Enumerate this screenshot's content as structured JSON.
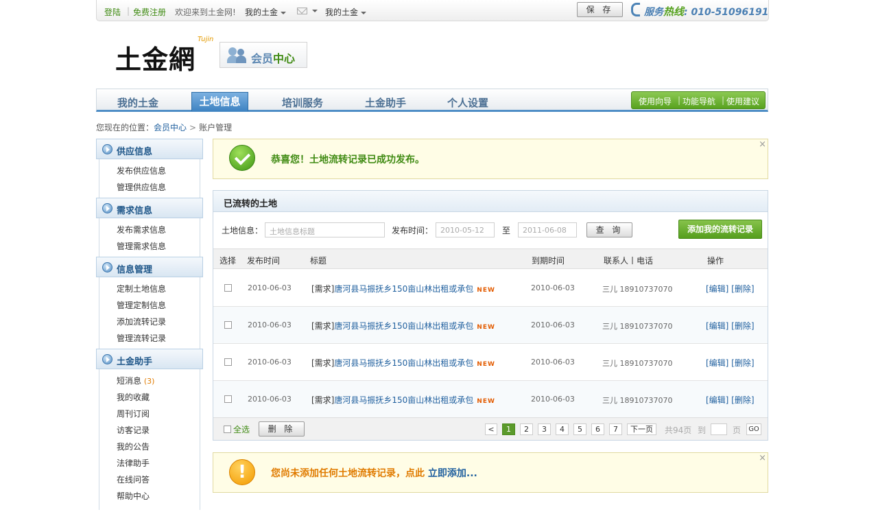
{
  "topbar": {
    "login": "登陆",
    "register": "免费注册",
    "welcome": "欢迎来到土金网!",
    "my_tujin_1": "我的土金",
    "my_tujin_2": "我的土金",
    "save": "保 存",
    "hotline_label": "服务",
    "hotline_hot": "热线",
    "hotline_number": "010-51096191"
  },
  "logo": {
    "text": "土金網",
    "sub": "Tujin",
    "member_a": "会员",
    "member_b": "中心"
  },
  "nav": {
    "items": [
      "我的土金",
      "土地信息",
      "培训服务",
      "土金助手",
      "个人设置"
    ],
    "active": "土地信息",
    "quick": [
      "使用向导",
      "功能导航",
      "使用建议"
    ]
  },
  "breadcrumb": {
    "prefix": "您现在的位置：",
    "link": "会员中心",
    "current": "账户管理"
  },
  "sidebar": {
    "sections": [
      {
        "title": "供应信息",
        "items": [
          "发布供应信息",
          "管理供应信息"
        ]
      },
      {
        "title": "需求信息",
        "items": [
          "发布需求信息",
          "管理需求信息"
        ]
      },
      {
        "title": "信息管理",
        "items": [
          "定制土地信息",
          "管理定制信息",
          "添加流转记录",
          "管理流转记录"
        ]
      },
      {
        "title": "土金助手",
        "items": [
          "短消息",
          "我的收藏",
          "周刊订阅",
          "访客记录",
          "我的公告",
          "法律助手",
          "在线问答",
          "帮助中心"
        ],
        "badge": "(3)"
      }
    ]
  },
  "success": {
    "message": "恭喜您！土地流转记录已成功发布。",
    "close": "×"
  },
  "panel": {
    "title": "已流转的土地",
    "filter_label": "土地信息：",
    "filter_placeholder": "土地信息标题",
    "date_label": "发布时间：",
    "date_from": "2010-05-12",
    "to": "至",
    "date_to": "2011-06-08",
    "query": "查 询",
    "add": "添加我的流转记录",
    "columns": [
      "选择",
      "发布时间",
      "标题",
      "到期时间",
      "联系人丨电话",
      "操作"
    ],
    "rows": [
      {
        "date": "2010-06-03",
        "tag": "[需求]",
        "title": "唐河县马振抚乡150亩山林出租或承包",
        "new": "NEW",
        "expire": "2010-06-03",
        "contact": "三儿 18910737070",
        "ops": "[编辑] [删除]"
      },
      {
        "date": "2010-06-03",
        "tag": "[需求]",
        "title": "唐河县马振抚乡150亩山林出租或承包",
        "new": "NEW",
        "expire": "2010-06-03",
        "contact": "三儿 18910737070",
        "ops": "[编辑] [删除]"
      },
      {
        "date": "2010-06-03",
        "tag": "[需求]",
        "title": "唐河县马振抚乡150亩山林出租或承包",
        "new": "NEW",
        "expire": "2010-06-03",
        "contact": "三儿 18910737070",
        "ops": "[编辑] [删除]"
      },
      {
        "date": "2010-06-03",
        "tag": "[需求]",
        "title": "唐河县马振抚乡150亩山林出租或承包",
        "new": "NEW",
        "expire": "2010-06-03",
        "contact": "三儿 18910737070",
        "ops": "[编辑] [删除]"
      }
    ],
    "select_all": "全选",
    "delete": "删 除",
    "pages": [
      "1",
      "2",
      "3",
      "4",
      "5",
      "6",
      "7"
    ],
    "current_page": "1",
    "next": "下一页",
    "total": "共94页",
    "goto": "到",
    "page_unit": "页",
    "go": "GO"
  },
  "warning": {
    "message": "您尚未添加任何土地流转记录，点此",
    "link": "立即添加...",
    "close": "×"
  }
}
